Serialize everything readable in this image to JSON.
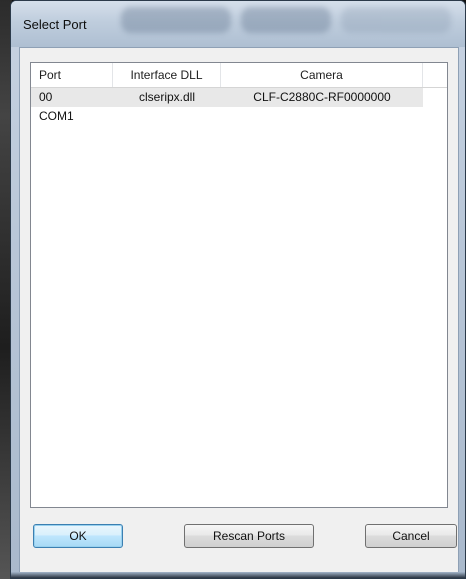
{
  "window": {
    "title": "Select Port"
  },
  "list": {
    "columns": [
      "Port",
      "Interface DLL",
      "Camera"
    ],
    "rows": [
      {
        "port": "00",
        "dll": "clseripx.dll",
        "camera": "CLF-C2880C-RF0000000"
      },
      {
        "port": "COM1",
        "dll": "",
        "camera": ""
      }
    ]
  },
  "buttons": {
    "ok": "OK",
    "rescan": "Rescan Ports",
    "cancel": "Cancel"
  }
}
